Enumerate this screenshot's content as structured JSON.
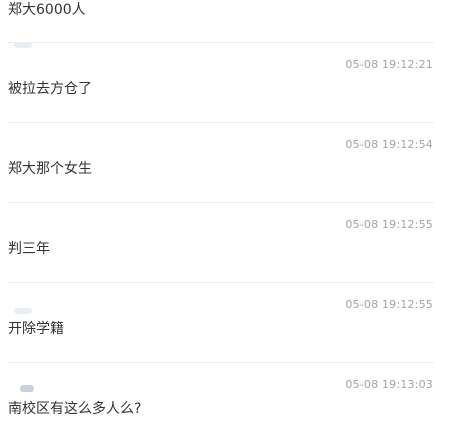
{
  "messages": [
    {
      "text": "郑大6000人",
      "time": ""
    },
    {
      "text": "被拉去方仓了",
      "time": "05-08 19:12:21"
    },
    {
      "text": "郑大那个女生",
      "time": "05-08 19:12:54"
    },
    {
      "text": "判三年",
      "time": "05-08 19:12:55"
    },
    {
      "text": "开除学籍",
      "time": "05-08 19:12:55"
    },
    {
      "text": "南校区有这么多人么?",
      "time": "05-08 19:13:03"
    }
  ],
  "colors": {
    "text": "#333333",
    "time": "#a3a3a3",
    "divider": "#ececec"
  }
}
